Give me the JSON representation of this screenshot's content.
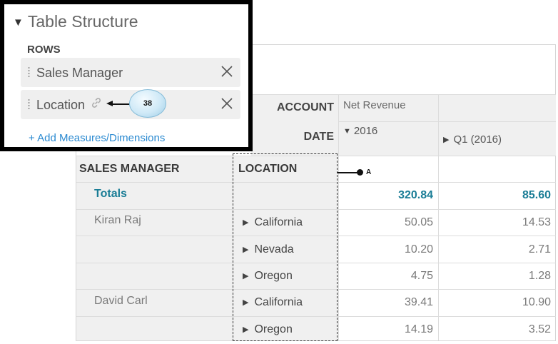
{
  "panel": {
    "title": "Table Structure",
    "rows_label": "ROWS",
    "chips": [
      {
        "label": "Sales Manager"
      },
      {
        "label": "Location"
      }
    ],
    "add_link": "+ Add Measures/Dimensions",
    "callout_38": "38"
  },
  "grid": {
    "account_label": "ACCOUNT",
    "date_label": "DATE",
    "measure": "Net Revenue",
    "col_2016": "2016",
    "col_q1": "Q1 (2016)",
    "sales_manager_header": "SALES MANAGER",
    "location_header": "LOCATION",
    "totals": {
      "label": "Totals",
      "v2016": "320.84",
      "vq1": "85.60"
    },
    "rows": [
      {
        "manager": "Kiran Raj",
        "location": "California",
        "v2016": "50.05",
        "vq1": "14.53"
      },
      {
        "manager": "",
        "location": "Nevada",
        "v2016": "10.20",
        "vq1": "2.71"
      },
      {
        "manager": "",
        "location": "Oregon",
        "v2016": "4.75",
        "vq1": "1.28"
      },
      {
        "manager": "David Carl",
        "location": "California",
        "v2016": "39.41",
        "vq1": "10.90"
      },
      {
        "manager": "",
        "location": "Oregon",
        "v2016": "14.19",
        "vq1": "3.52"
      }
    ],
    "callout_a": "A"
  },
  "colors": {
    "accent_link": "#2b8ad1",
    "totals_teal": "#1a7d96",
    "header_bg": "#f0f0f0"
  }
}
